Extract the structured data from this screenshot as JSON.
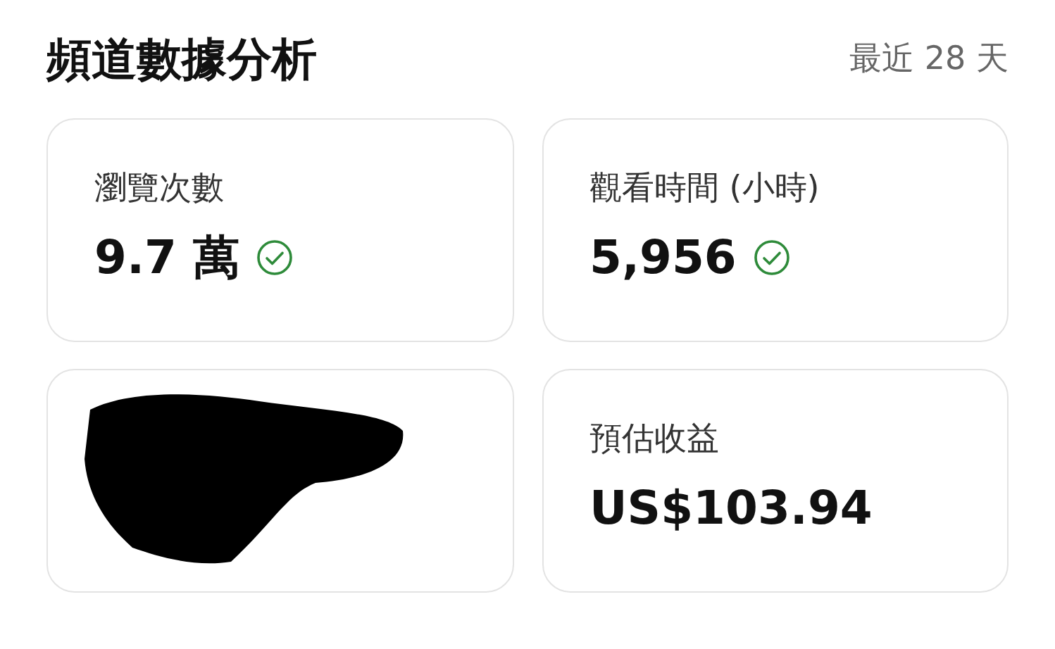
{
  "header": {
    "title": "頻道數據分析",
    "period": "最近 28 天"
  },
  "cards": [
    {
      "kind": "metric",
      "label": "瀏覽次數",
      "value": "9.7 萬",
      "verified": true
    },
    {
      "kind": "metric",
      "label": "觀看時間 (小時)",
      "value": "5,956",
      "verified": true
    },
    {
      "kind": "redacted"
    },
    {
      "kind": "metric",
      "label": "預估收益",
      "value": "US$103.94",
      "verified": false
    }
  ]
}
